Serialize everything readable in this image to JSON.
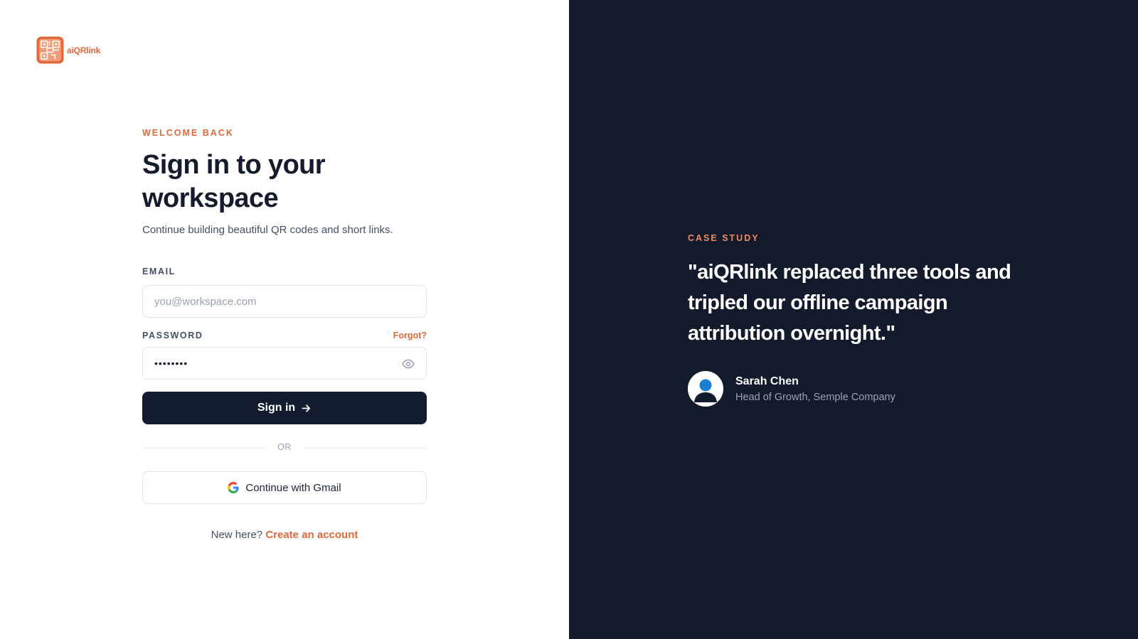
{
  "brand": {
    "name": "aiQRlink",
    "accent_color": "#e0683b",
    "dark_color": "#121a2c"
  },
  "signin": {
    "eyebrow": "WELCOME BACK",
    "title": "Sign in to your workspace",
    "subtitle": "Continue building beautiful QR codes and short links.",
    "email_label": "EMAIL",
    "email_placeholder": "you@workspace.com",
    "email_value": "",
    "password_label": "PASSWORD",
    "password_value": "••••••••",
    "forgot_label": "Forgot?",
    "submit_label": "Sign in",
    "divider_label": "OR",
    "gmail_label": "Continue with Gmail",
    "signup_prompt": "New here?",
    "signup_link": "Create an account"
  },
  "case_study": {
    "eyebrow": "CASE STUDY",
    "quote": "\"aiQRlink replaced three tools and tripled our offline campaign attribution overnight.\"",
    "author_name": "Sarah Chen",
    "author_role": "Head of Growth, Semple Company"
  },
  "icons": {
    "logo": "qr-logo-icon",
    "password_toggle": "eye-icon",
    "submit_arrow": "arrow-right-icon",
    "gmail": "google-g-icon",
    "avatar": "user-avatar-icon"
  }
}
